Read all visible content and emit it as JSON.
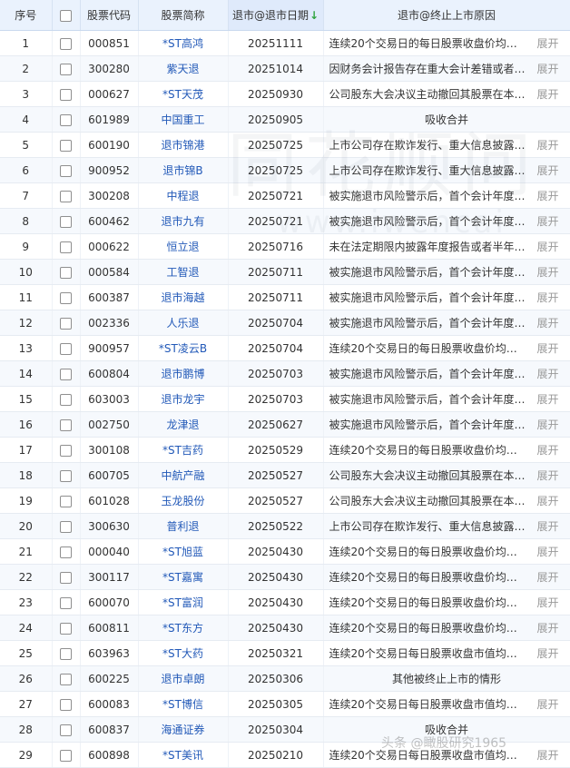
{
  "table": {
    "headers": {
      "seq": "序号",
      "code": "股票代码",
      "name": "股票简称",
      "date": "退市@退市日期",
      "sort_arrow": "↓",
      "reason": "退市@终止上市原因"
    },
    "expand_label": "展开",
    "rows": [
      {
        "seq": "1",
        "code": "000851",
        "name": "*ST高鸿",
        "date": "20251111",
        "reason": "连续20个交易日的每日股票收盘价均低...",
        "expand": true
      },
      {
        "seq": "2",
        "code": "300280",
        "name": "紫天退",
        "date": "20251014",
        "reason": "因财务会计报告存在重大会计差错或者虚...",
        "expand": true
      },
      {
        "seq": "3",
        "code": "000627",
        "name": "*ST天茂",
        "date": "20250930",
        "reason": "公司股东大会决议主动撤回其股票在本所...",
        "expand": true
      },
      {
        "seq": "4",
        "code": "601989",
        "name": "中国重工",
        "date": "20250905",
        "reason": "吸收合并",
        "expand": false
      },
      {
        "seq": "5",
        "code": "600190",
        "name": "退市锦港",
        "date": "20250725",
        "reason": "上市公司存在欺诈发行、重大信息披露违...",
        "expand": true
      },
      {
        "seq": "6",
        "code": "900952",
        "name": "退市锦B",
        "date": "20250725",
        "reason": "上市公司存在欺诈发行、重大信息披露违...",
        "expand": true
      },
      {
        "seq": "7",
        "code": "300208",
        "name": "中程退",
        "date": "20250721",
        "reason": "被实施退市风险警示后，首个会计年度财...",
        "expand": true
      },
      {
        "seq": "8",
        "code": "600462",
        "name": "退市九有",
        "date": "20250721",
        "reason": "被实施退市风险警示后，首个会计年度财...",
        "expand": true
      },
      {
        "seq": "9",
        "code": "000622",
        "name": "恒立退",
        "date": "20250716",
        "reason": "未在法定期限内披露年度报告或者半年度...",
        "expand": true
      },
      {
        "seq": "10",
        "code": "000584",
        "name": "工智退",
        "date": "20250711",
        "reason": "被实施退市风险警示后，首个会计年度财...",
        "expand": true
      },
      {
        "seq": "11",
        "code": "600387",
        "name": "退市海越",
        "date": "20250711",
        "reason": "被实施退市风险警示后，首个会计年度财...",
        "expand": true
      },
      {
        "seq": "12",
        "code": "002336",
        "name": "人乐退",
        "date": "20250704",
        "reason": "被实施退市风险警示后，首个会计年度财...",
        "expand": true
      },
      {
        "seq": "13",
        "code": "900957",
        "name": "*ST凌云B",
        "date": "20250704",
        "reason": "连续20个交易日的每日股票收盘价均低...",
        "expand": true
      },
      {
        "seq": "14",
        "code": "600804",
        "name": "退市鹏博",
        "date": "20250703",
        "reason": "被实施退市风险警示后，首个会计年度财...",
        "expand": true
      },
      {
        "seq": "15",
        "code": "603003",
        "name": "退市龙宇",
        "date": "20250703",
        "reason": "被实施退市风险警示后，首个会计年度财...",
        "expand": true
      },
      {
        "seq": "16",
        "code": "002750",
        "name": "龙津退",
        "date": "20250627",
        "reason": "被实施退市风险警示后，首个会计年度经...",
        "expand": true
      },
      {
        "seq": "17",
        "code": "300108",
        "name": "*ST吉药",
        "date": "20250529",
        "reason": "连续20个交易日的每日股票收盘价均低...",
        "expand": true
      },
      {
        "seq": "18",
        "code": "600705",
        "name": "中航产融",
        "date": "20250527",
        "reason": "公司股东大会决议主动撤回其股票在本所...",
        "expand": true
      },
      {
        "seq": "19",
        "code": "601028",
        "name": "玉龙股份",
        "date": "20250527",
        "reason": "公司股东大会决议主动撤回其股票在本所...",
        "expand": true
      },
      {
        "seq": "20",
        "code": "300630",
        "name": "普利退",
        "date": "20250522",
        "reason": "上市公司存在欺诈发行、重大信息披露违...",
        "expand": true
      },
      {
        "seq": "21",
        "code": "000040",
        "name": "*ST旭蓝",
        "date": "20250430",
        "reason": "连续20个交易日的每日股票收盘价均低...",
        "expand": true
      },
      {
        "seq": "22",
        "code": "300117",
        "name": "*ST嘉寓",
        "date": "20250430",
        "reason": "连续20个交易日的每日股票收盘价均低...",
        "expand": true
      },
      {
        "seq": "23",
        "code": "600070",
        "name": "*ST富润",
        "date": "20250430",
        "reason": "连续20个交易日的每日股票收盘价均低...",
        "expand": true
      },
      {
        "seq": "24",
        "code": "600811",
        "name": "*ST东方",
        "date": "20250430",
        "reason": "连续20个交易日的每日股票收盘价均低...",
        "expand": true
      },
      {
        "seq": "25",
        "code": "603963",
        "name": "*ST大药",
        "date": "20250321",
        "reason": "连续20个交易日每日股票收盘市值均低...",
        "expand": true
      },
      {
        "seq": "26",
        "code": "600225",
        "name": "退市卓朗",
        "date": "20250306",
        "reason": "其他被终止上市的情形",
        "expand": false
      },
      {
        "seq": "27",
        "code": "600083",
        "name": "*ST博信",
        "date": "20250305",
        "reason": "连续20个交易日每日股票收盘市值均低...",
        "expand": true
      },
      {
        "seq": "28",
        "code": "600837",
        "name": "海通证券",
        "date": "20250304",
        "reason": "吸收合并",
        "expand": false
      },
      {
        "seq": "29",
        "code": "600898",
        "name": "*ST美讯",
        "date": "20250210",
        "reason": "连续20个交易日每日股票收盘市值均低...",
        "expand": true
      }
    ]
  },
  "watermark": {
    "line1": "同花顺问",
    "line2": "www.iwencai"
  },
  "footer_watermark": "头条 @瞰股研究1965"
}
